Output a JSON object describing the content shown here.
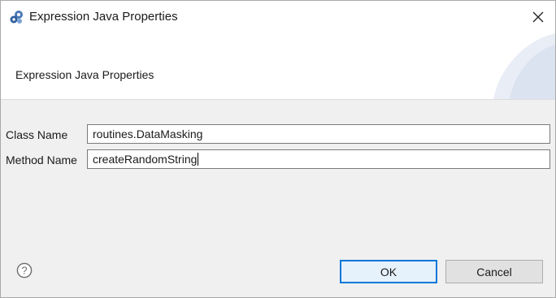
{
  "window": {
    "title": "Expression Java Properties"
  },
  "banner": {
    "title": "Expression Java Properties"
  },
  "form": {
    "class_name": {
      "label": "Class Name",
      "value": "routines.DataMasking"
    },
    "method_name": {
      "label": "Method Name",
      "value": "createRandomString"
    }
  },
  "buttons": {
    "ok": "OK",
    "cancel": "Cancel"
  },
  "colors": {
    "accent": "#0078d7",
    "content_bg": "#f0f0f0",
    "ok_bg": "#e5f1fb"
  }
}
